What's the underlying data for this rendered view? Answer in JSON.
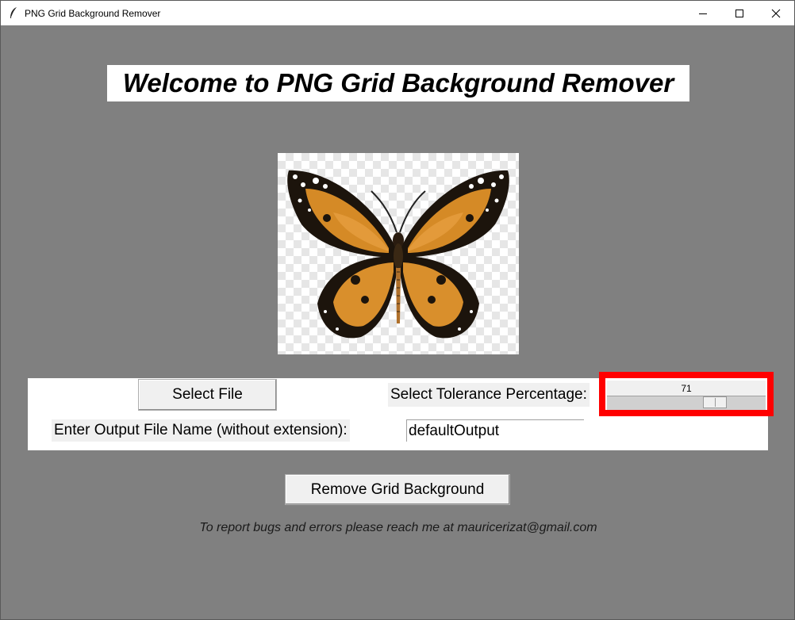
{
  "window": {
    "title": "PNG Grid Background Remover",
    "controls": [
      "minimize",
      "maximize",
      "close"
    ]
  },
  "heading": "Welcome to PNG Grid Background Remover",
  "preview": {
    "icon": "butterfly-image"
  },
  "select_file_button": "Select File",
  "tolerance": {
    "label": "Select Tolerance Percentage:",
    "value": "71",
    "value_fraction": 0.71
  },
  "output": {
    "label": "Enter Output File Name (without extension):",
    "value": "defaultOutput"
  },
  "remove_button": "Remove Grid Background",
  "footer": "To report bugs and errors please reach me at mauricerizat@gmail.com",
  "colors": {
    "background": "#808080",
    "highlight": "#ff0000"
  }
}
